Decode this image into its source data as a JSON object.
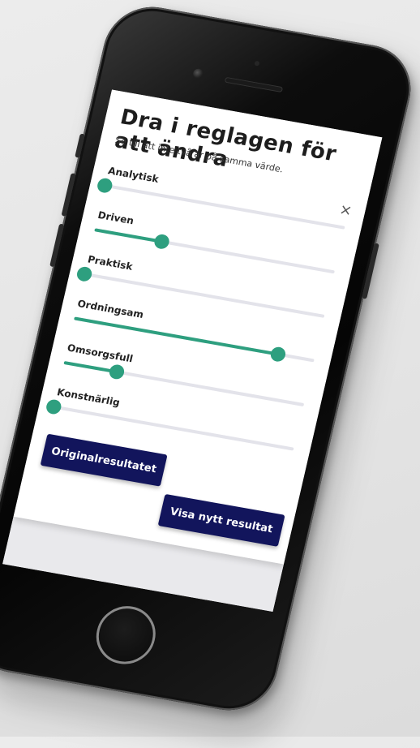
{
  "modal": {
    "title": "Dra i reglagen för att ändra",
    "subtitle": "Se till att inte två är på samma värde.",
    "close_symbol": "×"
  },
  "sliders": [
    {
      "label": "Analytisk",
      "value": 0.0
    },
    {
      "label": "Driven",
      "value": 0.28
    },
    {
      "label": "Praktisk",
      "value": 0.0
    },
    {
      "label": "Ordningsam",
      "value": 0.85
    },
    {
      "label": "Omsorgsfull",
      "value": 0.22
    },
    {
      "label": "Konstnärlig",
      "value": 0.0
    }
  ],
  "buttons": {
    "original_label": "Originalresultatet",
    "new_result_label": "Visa nytt resultat"
  },
  "colors": {
    "slider_accent": "#2e9f7f",
    "slider_track": "#e3e3ea",
    "button_bg": "#12155c",
    "button_text": "#ffffff"
  },
  "icons": {
    "close": "close-icon"
  }
}
